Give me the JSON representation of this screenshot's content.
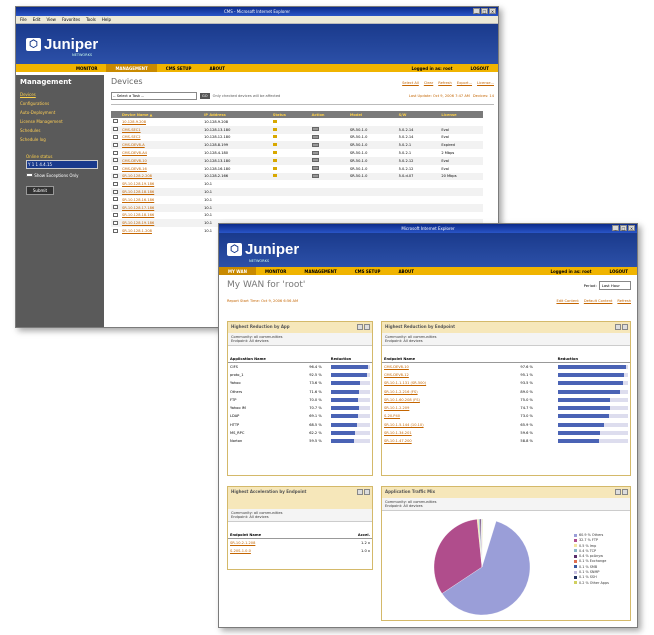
{
  "w1": {
    "title": "CMS - Microsoft Internet Explorer",
    "menu": [
      "File",
      "Edit",
      "View",
      "Favorites",
      "Tools",
      "Help"
    ],
    "brand": "Juniper",
    "brand_sub": "NETWORKS",
    "nav": [
      "MONITOR",
      "MANAGEMENT",
      "CMS SETUP",
      "ABOUT"
    ],
    "logged": "Logged in as: root",
    "logout": "LOGOUT",
    "side_title": "Management",
    "side_items": [
      "Devices",
      "Configurations",
      "Auto-Deployment",
      "License Management",
      "Schedules",
      "Schedule log"
    ],
    "side_label": "Online status",
    "side_select": "Y 1 1 4.4.15  ",
    "side_check": "Show Exceptions Only",
    "submit": "Submit",
    "page_title": "Devices",
    "top_links": [
      "Select All",
      "Clear",
      "Refresh",
      "Export...",
      "License..."
    ],
    "task_select": "-- Select a Task --",
    "go": "GO",
    "note": "Only checked devices will be affected",
    "last_update": "Last Update: Oct 9, 2006 7:47 AM",
    "devices_count": "Devices: 14",
    "cols": [
      "Device Name ▲",
      "IP Address",
      "Status",
      "Action",
      "Model",
      "S/W",
      "License"
    ],
    "rows": [
      [
        "10.128.9.208",
        "10.128.9.208",
        "",
        "",
        "",
        "",
        ""
      ],
      [
        "CMS-SEC1",
        "10.128.13.180",
        "",
        "",
        "SR-50-1.0",
        "5.0.2.14",
        "Eval"
      ],
      [
        "CMS-SEC2",
        "10.128.12.180",
        "",
        "",
        "SR-50-1.0",
        "5.0.2.14",
        "Eval"
      ],
      [
        "CMS-DEV8-A",
        "10.128.8.199",
        "",
        "",
        "SR-50-1.0",
        "5.0.2.1",
        "Expired"
      ],
      [
        "CMS-DEV8-A4",
        "10.128.4.180",
        "",
        "",
        "SR-50-1.0",
        "5.0.2.1",
        "2 Mbps"
      ],
      [
        "CMS-DEV8-10",
        "10.128.13.180",
        "",
        "",
        "SR-50-1.0",
        "5.0.2.12",
        "Eval"
      ],
      [
        "CMS-DEV8-16",
        "10.128.16.180",
        "",
        "",
        "SR-50-1.0",
        "5.0.2.12",
        "Eval"
      ],
      [
        "SR-10.128.2.208",
        "10.128.2.166",
        "",
        "",
        "SR-50-1.0",
        "5.0.d.07",
        "20 Mbps"
      ],
      [
        "SR-10.128.19.186",
        "10.1",
        "",
        "",
        "",
        "",
        ""
      ],
      [
        "SR-10.128.18.186",
        "10.1",
        "",
        "",
        "",
        "",
        ""
      ],
      [
        "SR-10.128.16.186",
        "10.1",
        "",
        "",
        "",
        "",
        ""
      ],
      [
        "SR-10.128.17.186",
        "10.1",
        "",
        "",
        "",
        "",
        ""
      ],
      [
        "SR-10.128.18.166",
        "10.1",
        "",
        "",
        "",
        "",
        ""
      ],
      [
        "SR-10.128.19.186",
        "10.1",
        "",
        "",
        "",
        "",
        ""
      ],
      [
        "SR-10.128.1.208",
        "10.1",
        "",
        "",
        "",
        "",
        ""
      ]
    ]
  },
  "w2": {
    "title": "Microsoft Internet Explorer",
    "brand": "Juniper",
    "brand_sub": "NETWORKS",
    "nav": [
      "MY WAN",
      "MONITOR",
      "MANAGEMENT",
      "CMS SETUP",
      "ABOUT"
    ],
    "logged": "Logged in as: root",
    "logout": "LOGOUT",
    "page_title": "My WAN for 'root'",
    "period_label": "Period:",
    "period_value": "Last Hour",
    "start_time": "Report Start Time: Oct 9, 2006 6:56 AM",
    "links": [
      "Edit Content",
      "Default Content",
      "Refresh"
    ],
    "p1": {
      "title": "Highest Reduction by App",
      "info1": "Community: all communities",
      "info2": "Endpoint: All devices",
      "c1": "Application Name",
      "c2": "Reduction",
      "rows": [
        [
          "CIFS",
          "96.4 %",
          0.96
        ],
        [
          "proto_1",
          "92.5 %",
          0.92
        ],
        [
          "Yahoo",
          "73.6 %",
          0.74
        ],
        [
          "Others",
          "71.6 %",
          0.72
        ],
        [
          "FTP",
          "70.0 %",
          0.7
        ],
        [
          "Yahoo IM",
          "70.7 %",
          0.71
        ],
        [
          "LDAP",
          "69.1 %",
          0.69
        ],
        [
          "HTTP",
          "68.5 %",
          0.68
        ],
        [
          "MS_RPC",
          "62.2 %",
          0.62
        ],
        [
          "Norton",
          "59.5 %",
          0.59
        ]
      ]
    },
    "p2": {
      "title": "Highest Reduction by Endpoint",
      "info1": "Community: all communities",
      "info2": "Endpoint: All devices",
      "c1": "Endpoint Name",
      "c2": "Reduction",
      "rows": [
        [
          "CMS-DEV8-10",
          "97.6 %",
          0.97
        ],
        [
          "CMS-DEV8-12",
          "95.1 %",
          0.95
        ],
        [
          "SR-10.1.1.131 (SR-500)",
          "93.5 %",
          0.93
        ],
        [
          "SR-10.1.2.216 (FS)",
          "89.0 %",
          0.89
        ],
        [
          "SR-10.1.60.208 (FS)",
          "75.0 %",
          0.75
        ],
        [
          "SR-10.1.2.209",
          "74.7 %",
          0.75
        ],
        [
          "S-20.P40",
          "73.0 %",
          0.73
        ],
        [
          "SR-10.1.5.144 (10.10)",
          "65.9 %",
          0.66
        ],
        [
          "SR-10.1.34.201",
          "59.6 %",
          0.6
        ],
        [
          "SR-10.1.47.200",
          "58.8 %",
          0.59
        ]
      ]
    },
    "p3": {
      "title": "Highest Acceleration by Endpoint",
      "info1": "Community: all communities",
      "info2": "Endpoint: All devices",
      "c1": "Endpoint Name",
      "c2": "Accel.",
      "rows": [
        [
          "SR-10.2.1.208",
          "1.2 x"
        ],
        [
          "S-20S-1.0.0",
          "1.0 x"
        ]
      ]
    },
    "p4": {
      "title": "Application Traffic Mix",
      "info1": "Community: all communities",
      "info2": "Endpoint: All devices",
      "legend": [
        [
          "60.9 % Others",
          "#9a9ed8"
        ],
        [
          "32.7 % FTP",
          "#b04d8c"
        ],
        [
          "0.5 % Imp",
          "#f2e6a0"
        ],
        [
          "0.4 % TCP",
          "#8ab6c8"
        ],
        [
          "0.4 % pcAnyw",
          "#5a2d6a"
        ],
        [
          "0.1 % Exchange",
          "#e07050"
        ],
        [
          "0.1 % SMB",
          "#3a5aa0"
        ],
        [
          "0.1 % SNMP",
          "#c8c0e0"
        ],
        [
          "0.1 % SSH",
          "#203060"
        ],
        [
          "0.2 % Other Apps",
          "#d0d060"
        ]
      ]
    }
  }
}
